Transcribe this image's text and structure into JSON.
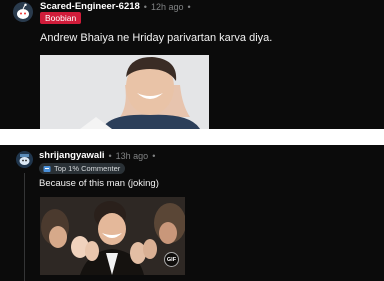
{
  "post1": {
    "username": "Scared-Engineer-6218",
    "time": "12h ago",
    "dot": "•",
    "flair": "Boobian",
    "text": "Andrew Bhaiya ne Hriday parivartan karva diya."
  },
  "post2": {
    "username": "shrijangyawali",
    "time": "13h ago",
    "dot": "•",
    "flair": "Top 1% Commenter",
    "text": "Because of this man (joking)",
    "gif_badge": "GIF"
  },
  "colors": {
    "background": "#0b0b0b",
    "flair_red": "#d01c3a",
    "muted": "#818384"
  }
}
